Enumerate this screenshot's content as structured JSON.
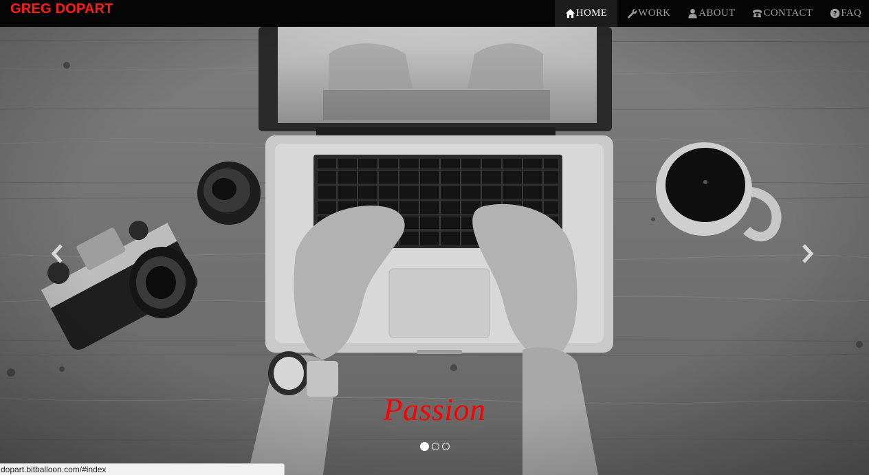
{
  "brand": "GREG DOPART",
  "nav": {
    "items": [
      {
        "label": "HOME",
        "icon": "home-icon",
        "active": true
      },
      {
        "label": "WORK",
        "icon": "wrench-icon",
        "active": false
      },
      {
        "label": "ABOUT",
        "icon": "user-icon",
        "active": false
      },
      {
        "label": "CONTACT",
        "icon": "phone-icon",
        "active": false
      },
      {
        "label": "FAQ",
        "icon": "question-circle-icon",
        "active": false
      }
    ]
  },
  "carousel": {
    "caption": "Passion",
    "slide_count": 3,
    "active_slide": 1,
    "controls": [
      "chevron-left-icon",
      "chevron-right-icon"
    ]
  },
  "statusbar": {
    "url": "dopart.bitballoon.com/#index"
  },
  "colors": {
    "brand": "#ff1a1a",
    "caption": "#ff0000",
    "navbar_bg": "#050505",
    "nav_text": "#9d9d9d",
    "nav_active_text": "#ffffff"
  }
}
